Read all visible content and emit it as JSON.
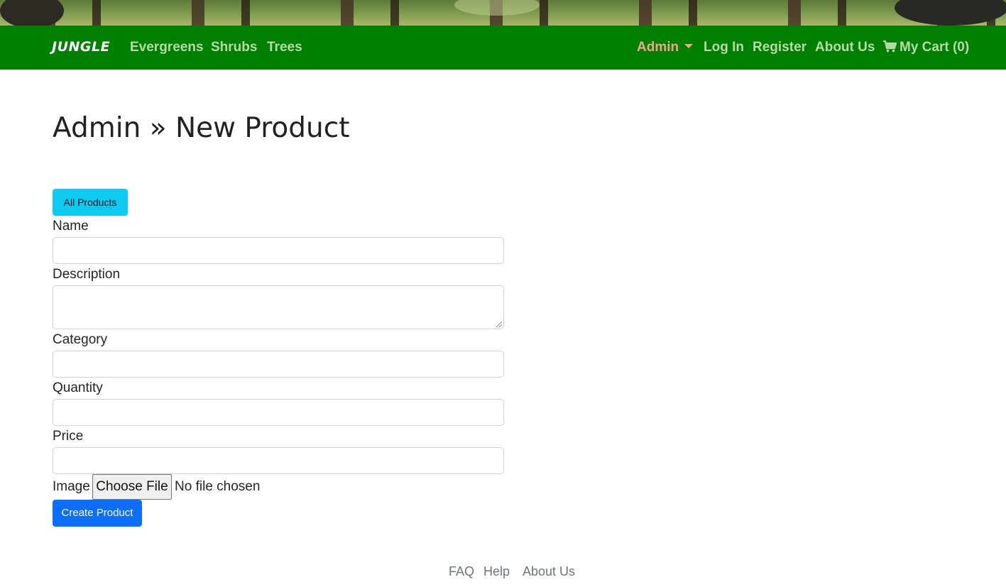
{
  "navbar": {
    "brand": "JUNGLE",
    "left_links": [
      "Evergreens",
      "Shrubs",
      "Trees"
    ],
    "admin_label": "Admin",
    "right_links": [
      "Log In",
      "Register",
      "About Us"
    ],
    "cart_label": "My Cart (0)",
    "colors": {
      "background": "#008000",
      "link": "#b7d9a8",
      "admin": "#f0a58e"
    }
  },
  "page": {
    "title": "Admin » New Product",
    "all_products_button": "All Products"
  },
  "form": {
    "name_label": "Name",
    "name_value": "",
    "description_label": "Description",
    "description_value": "",
    "category_label": "Category",
    "category_value": "",
    "quantity_label": "Quantity",
    "quantity_value": "",
    "price_label": "Price",
    "price_value": "",
    "image_label": "Image",
    "file_button": "Choose File",
    "file_status": "No file chosen",
    "submit_button": "Create Product"
  },
  "footer": {
    "links": [
      "FAQ",
      "Help",
      "About Us"
    ]
  }
}
